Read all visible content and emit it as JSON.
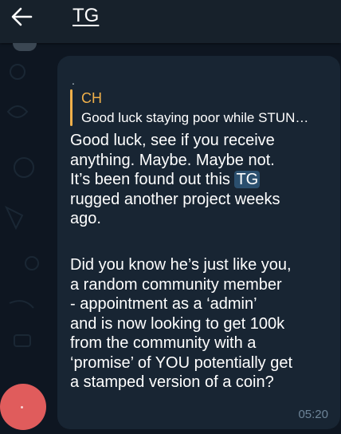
{
  "header": {
    "title": "TG"
  },
  "message": {
    "top_marker": ".",
    "reply": {
      "sender": "CH",
      "snippet": "Good luck staying poor while STUN…"
    },
    "paragraph1": {
      "line1": "Good luck, see if you receive",
      "line2": "anything. Maybe. Maybe not.",
      "line3_before": "It’s been found out this ",
      "line3_highlight": "TG",
      "line4": "rugged another project weeks",
      "line5": "ago."
    },
    "paragraph2": {
      "line1": "Did you know he’s just like you,",
      "line2": "a random community member",
      "line3": "- appointment as a ‘admin’",
      "line4": "and is now looking to get 100k",
      "line5": "from the community with a",
      "line6": "‘promise’ of YOU potentially get",
      "line7": "a stamped version of a coin?"
    },
    "time": "05:20"
  },
  "colors": {
    "chat_background": "#0e1621",
    "header_background": "#17212b",
    "bubble_background": "#182533",
    "reply_accent": "#f0b04a",
    "mention_highlight": "#2b4f6e",
    "timestamp": "#6d8498",
    "fab": "#e05c5c"
  },
  "icons": {
    "back": "arrow-left-icon"
  }
}
